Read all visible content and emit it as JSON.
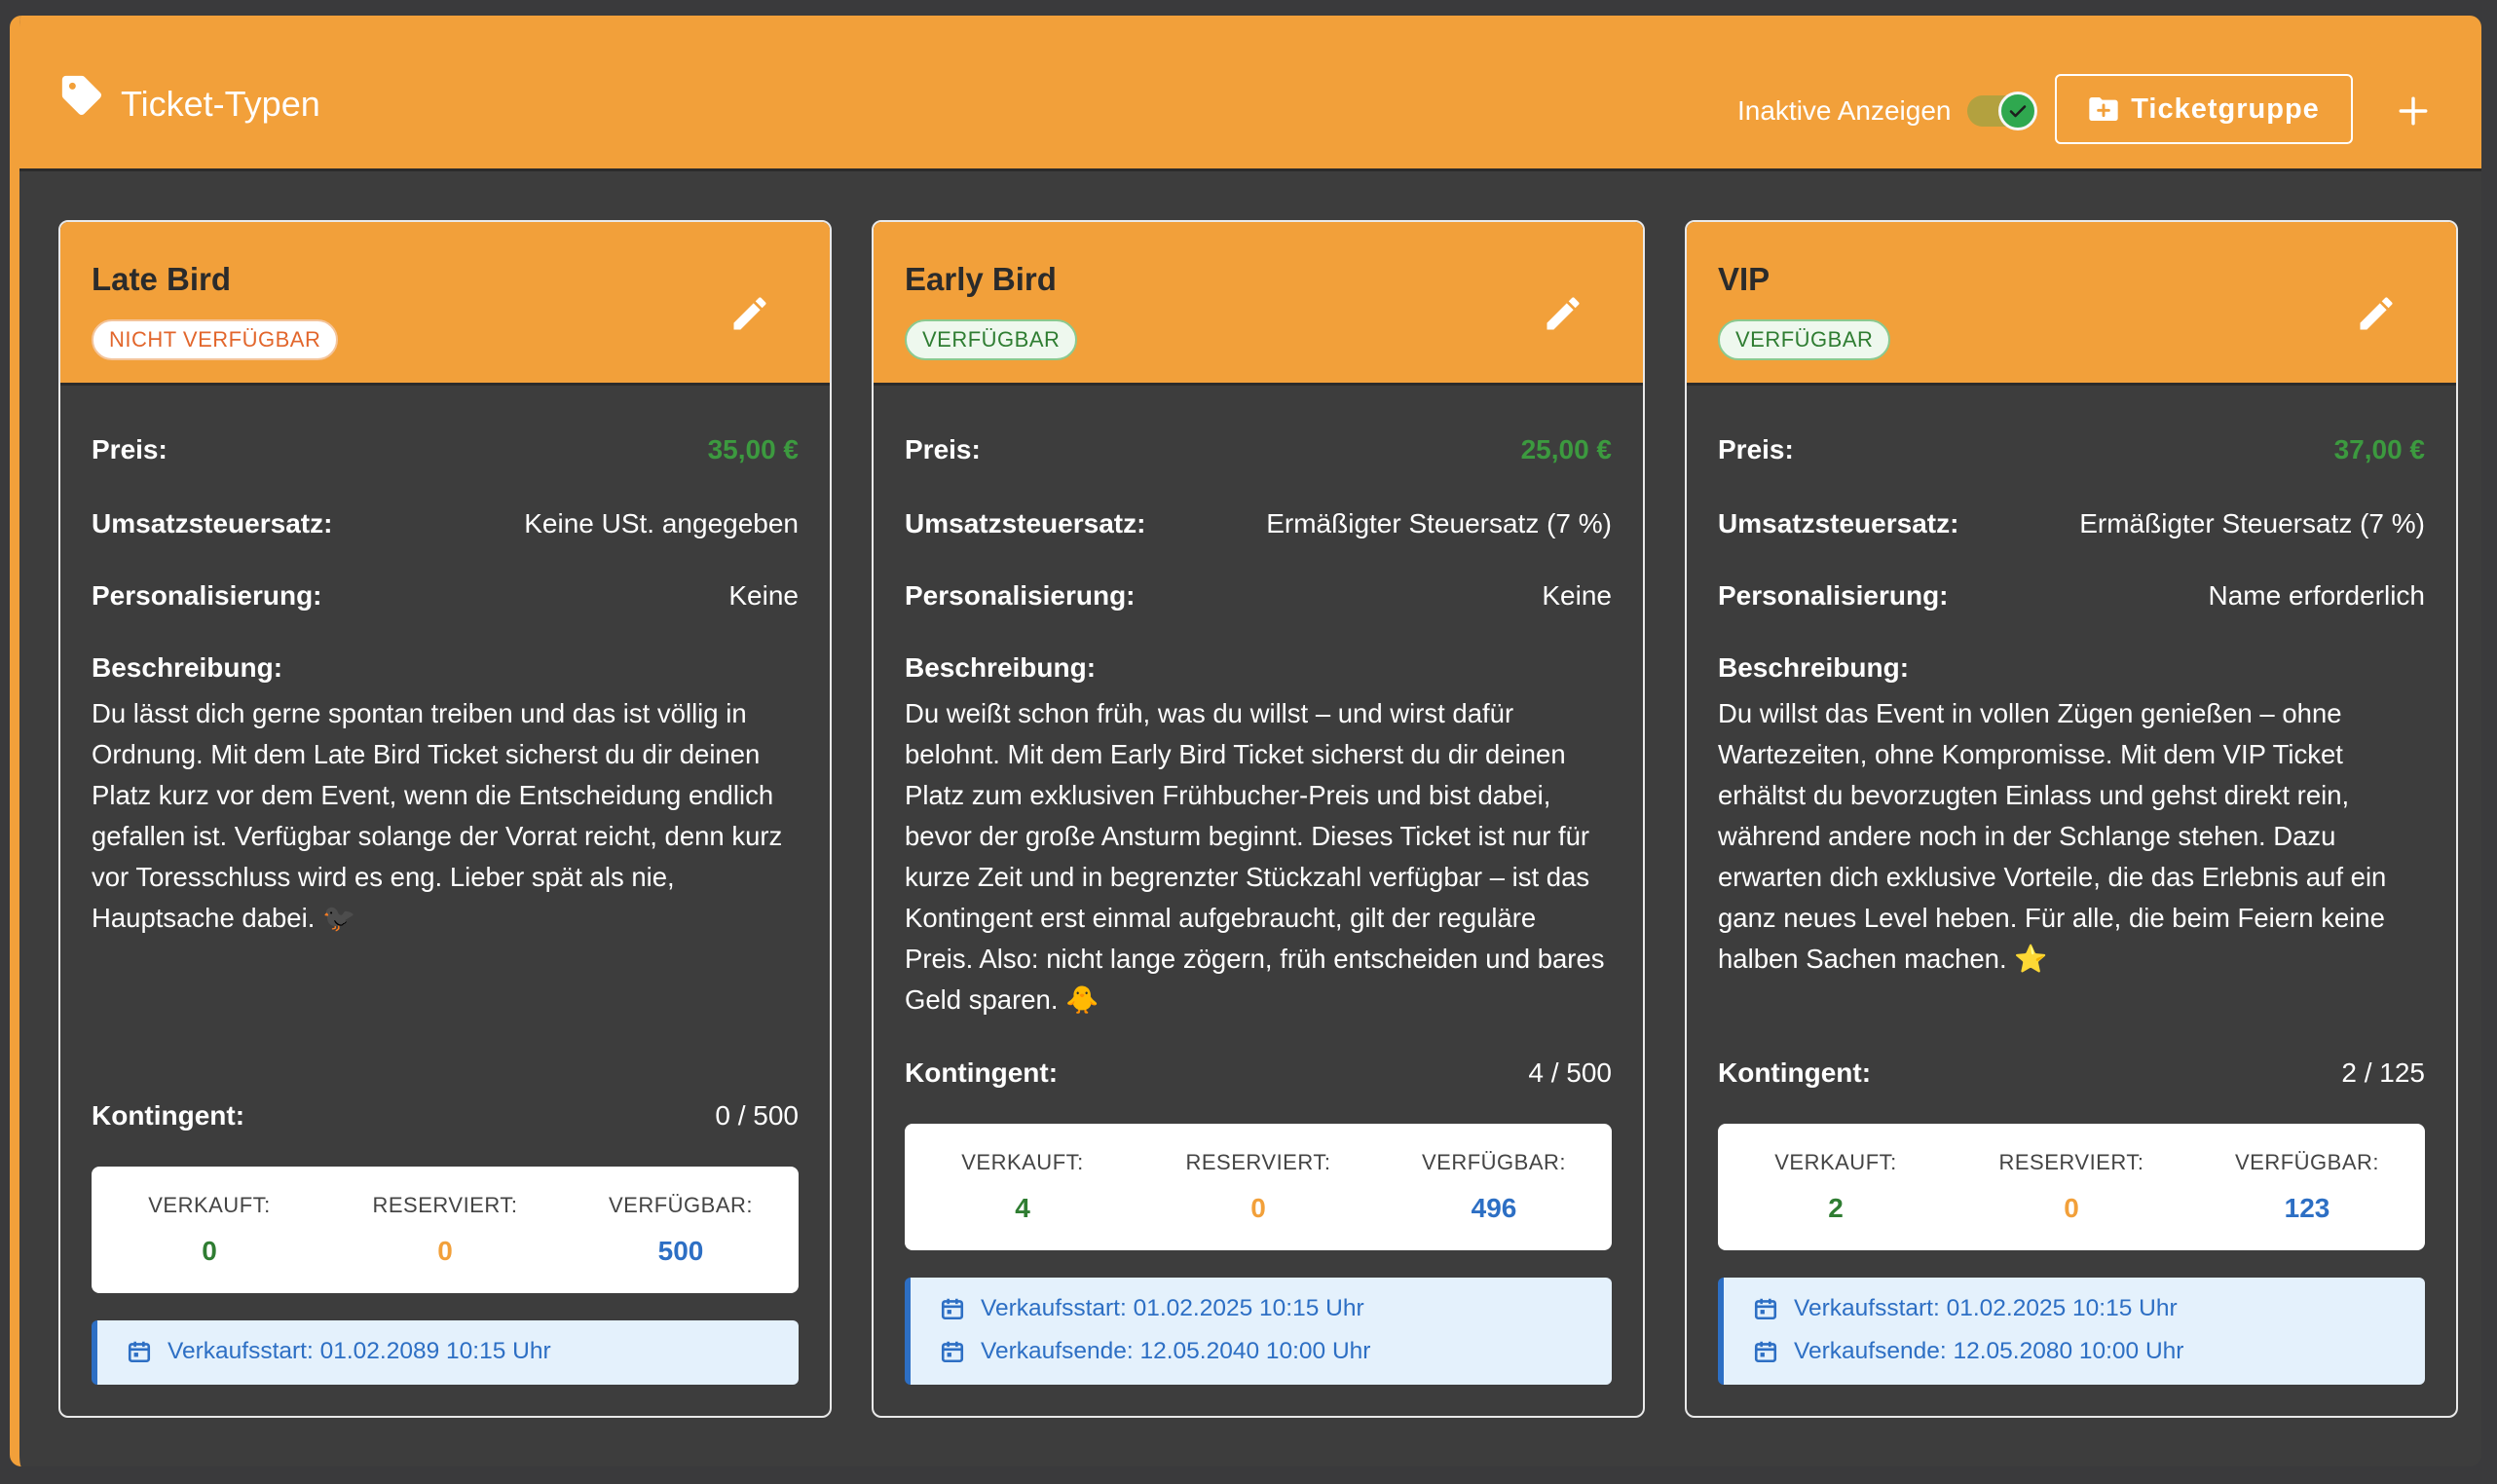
{
  "header": {
    "title": "Ticket-Typen",
    "toggle_label": "Inaktive Anzeigen",
    "group_button": "Ticketgruppe"
  },
  "labels": {
    "price": "Preis:",
    "tax": "Umsatzsteuersatz:",
    "personal": "Personalisierung:",
    "desc": "Beschreibung:",
    "quota": "Kontingent:",
    "sold": "VERKAUFT:",
    "reserved": "RESERVIERT:",
    "available": "VERFÜGBAR:"
  },
  "cards": [
    {
      "title": "Late Bird",
      "badge": "NICHT VERFÜGBAR",
      "price": "35,00 €",
      "tax": "Keine USt. angegeben",
      "personal": "Keine",
      "desc": "Du lässt dich gerne spontan treiben und das ist völlig in Ordnung. Mit dem Late Bird Ticket sicherst du dir deinen Platz kurz vor dem Event, wenn die Entscheidung endlich gefallen ist. Verfügbar solange der Vorrat reicht, denn kurz vor Toresschluss wird es eng. Lieber spät als nie, Hauptsache dabei. 🐦‍⬛",
      "quota": "0 / 500",
      "sold": "0",
      "reserved": "0",
      "available": "500",
      "sale_start": "Verkaufsstart: 01.02.2089 10:15 Uhr"
    },
    {
      "title": "Early Bird",
      "badge": "VERFÜGBAR",
      "price": "25,00 €",
      "tax": "Ermäßigter Steuersatz (7 %)",
      "personal": "Keine",
      "desc": "Du weißt schon früh, was du willst – und wirst dafür belohnt. Mit dem Early Bird Ticket sicherst du dir deinen Platz zum exklusiven Frühbucher-Preis und bist dabei, bevor der große Ansturm beginnt. Dieses Ticket ist nur für kurze Zeit und in begrenzter Stückzahl verfügbar – ist das Kontingent erst einmal aufgebraucht, gilt der reguläre Preis. Also: nicht lange zögern, früh entscheiden und bares Geld sparen. 🐥",
      "quota": "4 / 500",
      "sold": "4",
      "reserved": "0",
      "available": "496",
      "sale_start": "Verkaufsstart: 01.02.2025 10:15 Uhr",
      "sale_end": "Verkaufsende: 12.05.2040 10:00 Uhr"
    },
    {
      "title": "VIP",
      "badge": "VERFÜGBAR",
      "price": "37,00 €",
      "tax": "Ermäßigter Steuersatz (7 %)",
      "personal": "Name erforderlich",
      "desc": "Du willst das Event in vollen Zügen genießen – ohne Wartezeiten, ohne Kompromisse. Mit dem VIP Ticket erhältst du bevorzugten Einlass und gehst direkt rein, während andere noch in der Schlange stehen. Dazu erwarten dich exklusive Vorteile, die das Erlebnis auf ein ganz neues Level heben. Für alle, die beim Feiern keine halben Sachen machen. ⭐",
      "quota": "2 / 125",
      "sold": "2",
      "reserved": "0",
      "available": "123",
      "sale_start": "Verkaufsstart: 01.02.2025 10:15 Uhr",
      "sale_end": "Verkaufsende: 12.05.2080 10:00 Uhr"
    }
  ],
  "colors": {
    "accent": "#f2a03a",
    "price_green": "#3c9a3f",
    "sold_green": "#2f7d32",
    "reserved_orange": "#f2a03a",
    "available_blue": "#2d6fc4"
  },
  "icons": {
    "header": "tag-icon",
    "group_button": "folder-plus-icon",
    "add": "plus-icon",
    "edit": "pencil-icon",
    "sale": "calendar-icon",
    "toggle": "check-icon"
  }
}
